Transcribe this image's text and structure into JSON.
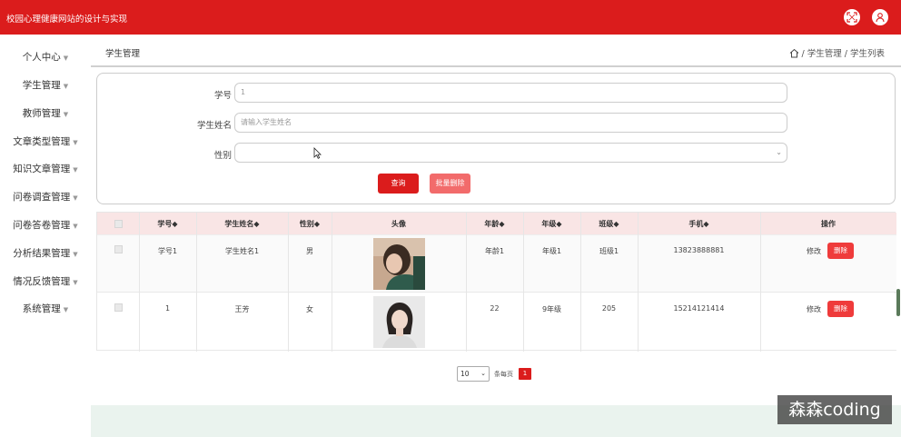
{
  "header": {
    "app_title": "校园心理健康网站的设计与实现",
    "icons": [
      "fullscreen-icon",
      "user-icon"
    ]
  },
  "sidebar": {
    "items": [
      {
        "label": "个人中心"
      },
      {
        "label": "学生管理"
      },
      {
        "label": "教师管理"
      },
      {
        "label": "文章类型管理"
      },
      {
        "label": "知识文章管理"
      },
      {
        "label": "问卷调查管理"
      },
      {
        "label": "问卷答卷管理"
      },
      {
        "label": "分析结果管理"
      },
      {
        "label": "情况反馈管理"
      },
      {
        "label": "系统管理"
      }
    ],
    "chevron": "▼"
  },
  "breadcrumb": {
    "page_title": "学生管理",
    "trail": "/ 学生管理 / 学生列表"
  },
  "search": {
    "student_no_label": "学号",
    "student_no_value": "1",
    "student_name_label": "学生姓名",
    "student_name_placeholder": "请输入学生姓名",
    "gender_label": "性别",
    "gender_value": "",
    "query_button": "查询",
    "batch_delete_button": "批量删除"
  },
  "table": {
    "columns": [
      "学号◆",
      "学生姓名◆",
      "性别◆",
      "头像",
      "年龄◆",
      "年级◆",
      "班级◆",
      "手机◆",
      "操作"
    ],
    "rows": [
      {
        "student_no": "学号1",
        "name": "学生姓名1",
        "gender": "男",
        "age": "年龄1",
        "grade": "年级1",
        "class": "班级1",
        "phone": "13823888881",
        "edit": "修改",
        "delete": "删除"
      },
      {
        "student_no": "1",
        "name": "王芳",
        "gender": "女",
        "age": "22",
        "grade": "9年级",
        "class": "205",
        "phone": "15214121414",
        "edit": "修改",
        "delete": "删除"
      }
    ]
  },
  "pagination": {
    "page_size": "10",
    "per_page_text": "条每页",
    "current_page": "1"
  },
  "watermark": "森森coding",
  "colors": {
    "brand_red": "#db1c1c",
    "header_row_bg": "#f9e5e5",
    "delete_red": "#ef3b3b",
    "batch_delete_pink": "#f26b6b"
  }
}
